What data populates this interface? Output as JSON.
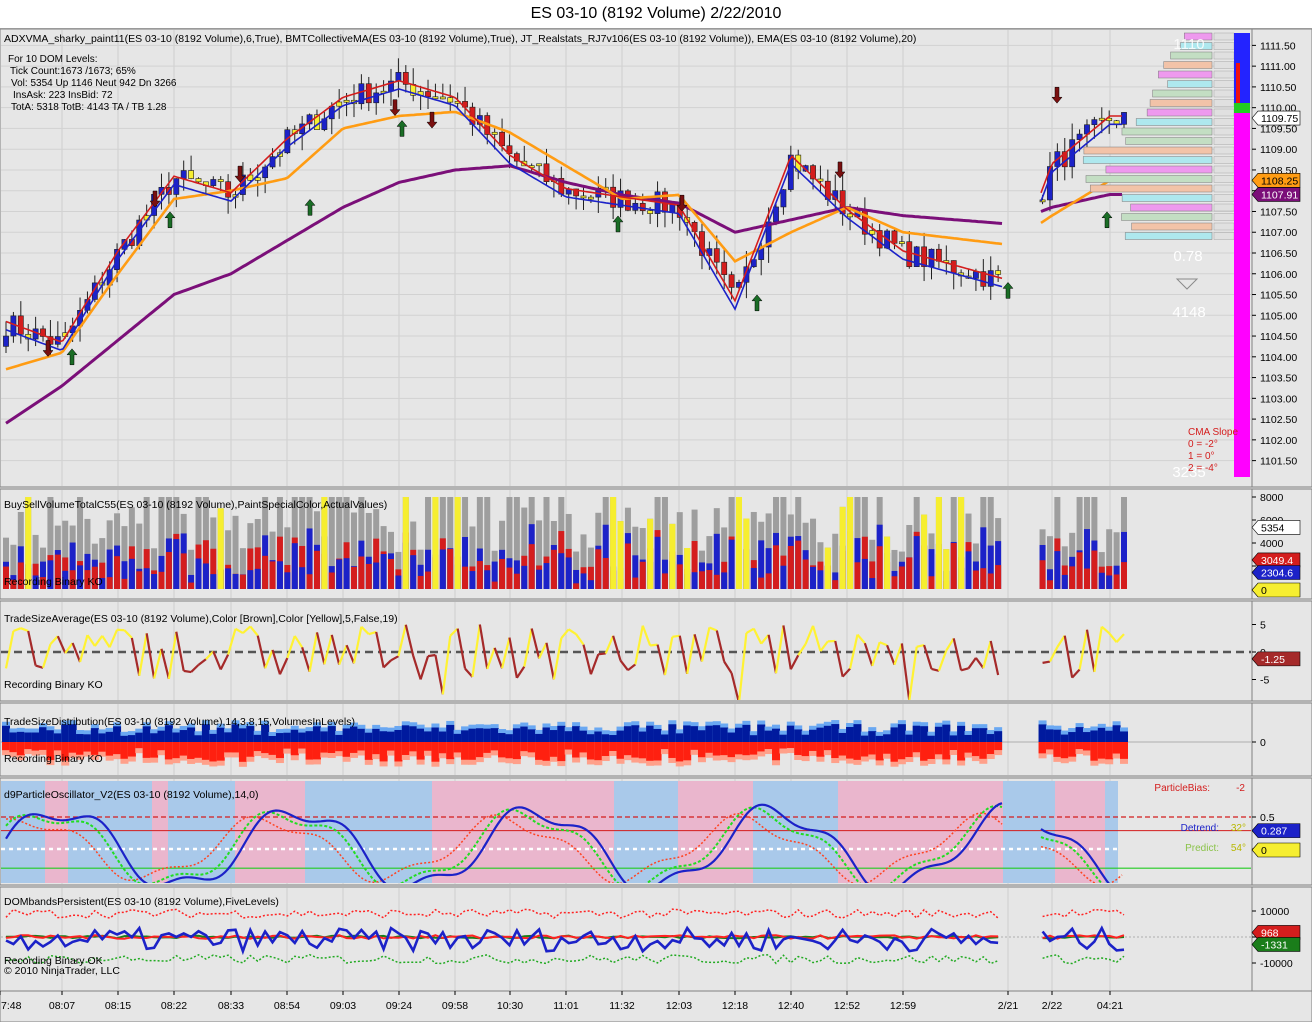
{
  "window": {
    "title": "ES 03-10 (8192 Volume)  2/22/2010"
  },
  "colors": {
    "bg": "#e6e6e6",
    "up": "#1c22c8",
    "down": "#d41d1d",
    "neutral": "#f6ee30",
    "purple": "#7b0f79",
    "orange": "#ff9c13",
    "magenta": "#ff00ff",
    "pink": "#eab6cd",
    "lightblue": "#a9c9ea",
    "grey": "#a0a0a0"
  },
  "panels": {
    "price": {
      "header": "ADXVMA_sharky_paint11(ES 03-10 (8192 Volume),6,True), BMTCollectiveMA(ES 03-10 (8192 Volume),True), JT_Realstats_RJ7v106(ES 03-10 (8192 Volume)), EMA(ES 03-10 (8192 Volume),20)",
      "stats": [
        "For 10 DOM Levels:",
        "Tick Count:1673 /1673; 65%",
        "Vol: 5354   Up 1146   Neut  942   Dn 3266",
        "InsAsk: 223   InsBid: 72",
        "TotA: 5318  TotB: 4143   TA / TB 1.28"
      ],
      "ratio": "0.78",
      "count": "4148",
      "count2": "3235",
      "ladder_top": "1110",
      "cma_slope": [
        "CMA Slope",
        "0 = -2°",
        "1 = 0°",
        "2 = -4°"
      ],
      "axis_ticks": [
        "1111.50",
        "1111.00",
        "1110.50",
        "1110.00",
        "1109.50",
        "1109.00",
        "1108.50",
        "1108.00",
        "1107.50",
        "1107.00",
        "1106.50",
        "1106.00",
        "1105.50",
        "1105.00",
        "1104.50",
        "1104.00",
        "1103.50",
        "1103.00",
        "1102.50",
        "1102.00",
        "1101.50"
      ],
      "last_price": "1109.75",
      "marker_a": "1108.25",
      "marker_b": "1107.91"
    },
    "volume": {
      "header": "BuySellVolumeTotalC55(ES 03-10 (8192 Volume),PaintSpecialColor,ActualValues)",
      "footer": "Recording Binary KO",
      "axis_ticks": [
        "8000",
        "6000",
        "4000",
        "2000"
      ],
      "tag_top": "5354",
      "tag_red": "3049.4",
      "tag_blue": "2304.6",
      "tag_zero": "0"
    },
    "tradesize": {
      "header": "TradeSizeAverage(ES 03-10 (8192 Volume),Color [Brown],Color [Yellow],5,False,19)",
      "footer": "Recording Binary KO",
      "axis_ticks": [
        "5",
        "0",
        "-5"
      ],
      "tag": "-1.25"
    },
    "distribution": {
      "header": "TradeSizeDistribution(ES 03-10 (8192 Volume),14,3,8,15,VolumesInLevels)",
      "footer": "Recording Binary KO",
      "axis_ticks": [
        "0"
      ]
    },
    "particle": {
      "header": "d9ParticleOscillator_V2(ES 03-10 (8192 Volume),14,0)",
      "bias_label": "ParticleBias:",
      "bias_val": "-2",
      "detrend_label": "Detrend:",
      "detrend_val": "32°",
      "predict_label": "Predict:",
      "predict_val": "54°",
      "axis_ticks": [
        "0.5",
        "0.287",
        "0"
      ],
      "tag": "0.287",
      "tag_zero": "0"
    },
    "dom": {
      "header": "DOMbandsPersistent(ES 03-10 (8192 Volume),FiveLevels)",
      "footer": "Recording Binary OK",
      "copyright": "© 2010 NinjaTrader, LLC",
      "axis_ticks": [
        "10000",
        "0",
        "-10000"
      ],
      "tag_red": "968",
      "tag_blue": "-1331"
    }
  },
  "time_axis": [
    "7:48",
    "08:07",
    "08:15",
    "08:22",
    "08:33",
    "08:54",
    "09:03",
    "09:24",
    "09:58",
    "10:30",
    "11:01",
    "11:32",
    "12:03",
    "12:18",
    "12:40",
    "12:52",
    "12:59",
    "2/21",
    "2/22",
    "04:21"
  ],
  "chart_data": {
    "type": "line",
    "title": "ES 03-10 (8192 Volume)  2/22/2010",
    "instrument": "ES 03-10",
    "ylim": [
      1101.25,
      1111.75
    ],
    "x": [
      "7:48",
      "08:07",
      "08:15",
      "08:22",
      "08:33",
      "08:54",
      "09:03",
      "09:24",
      "09:58",
      "10:30",
      "11:01",
      "11:32",
      "12:03",
      "12:18",
      "12:40",
      "12:52",
      "12:59",
      "2/21",
      "2/22",
      "04:21"
    ],
    "series": [
      {
        "values": [
          1104.8,
          1104.3,
          1106.5,
          1108.3,
          1107.9,
          1109.2,
          1110.2,
          1110.6,
          1110.2,
          1108.8,
          1108.0,
          1107.8,
          1107.6,
          1105.3,
          1108.8,
          1107.5,
          1106.5,
          1105.8,
          1108.6,
          1109.75
        ]
      },
      {
        "values": [
          1103.7,
          1104.1,
          1106.0,
          1107.8,
          1108.0,
          1108.3,
          1109.5,
          1109.8,
          1109.9,
          1109.4,
          1108.6,
          1107.8,
          1107.9,
          1106.3,
          1107.0,
          1107.6,
          1107.0,
          1106.7,
          1107.4,
          1108.25
        ]
      },
      {
        "values": [
          1102.4,
          1103.3,
          1104.4,
          1105.5,
          1106.0,
          1106.8,
          1107.6,
          1108.2,
          1108.5,
          1108.6,
          1108.2,
          1107.9,
          1107.7,
          1107.0,
          1107.3,
          1107.6,
          1107.4,
          1107.2,
          1107.6,
          1107.91
        ]
      }
    ]
  }
}
